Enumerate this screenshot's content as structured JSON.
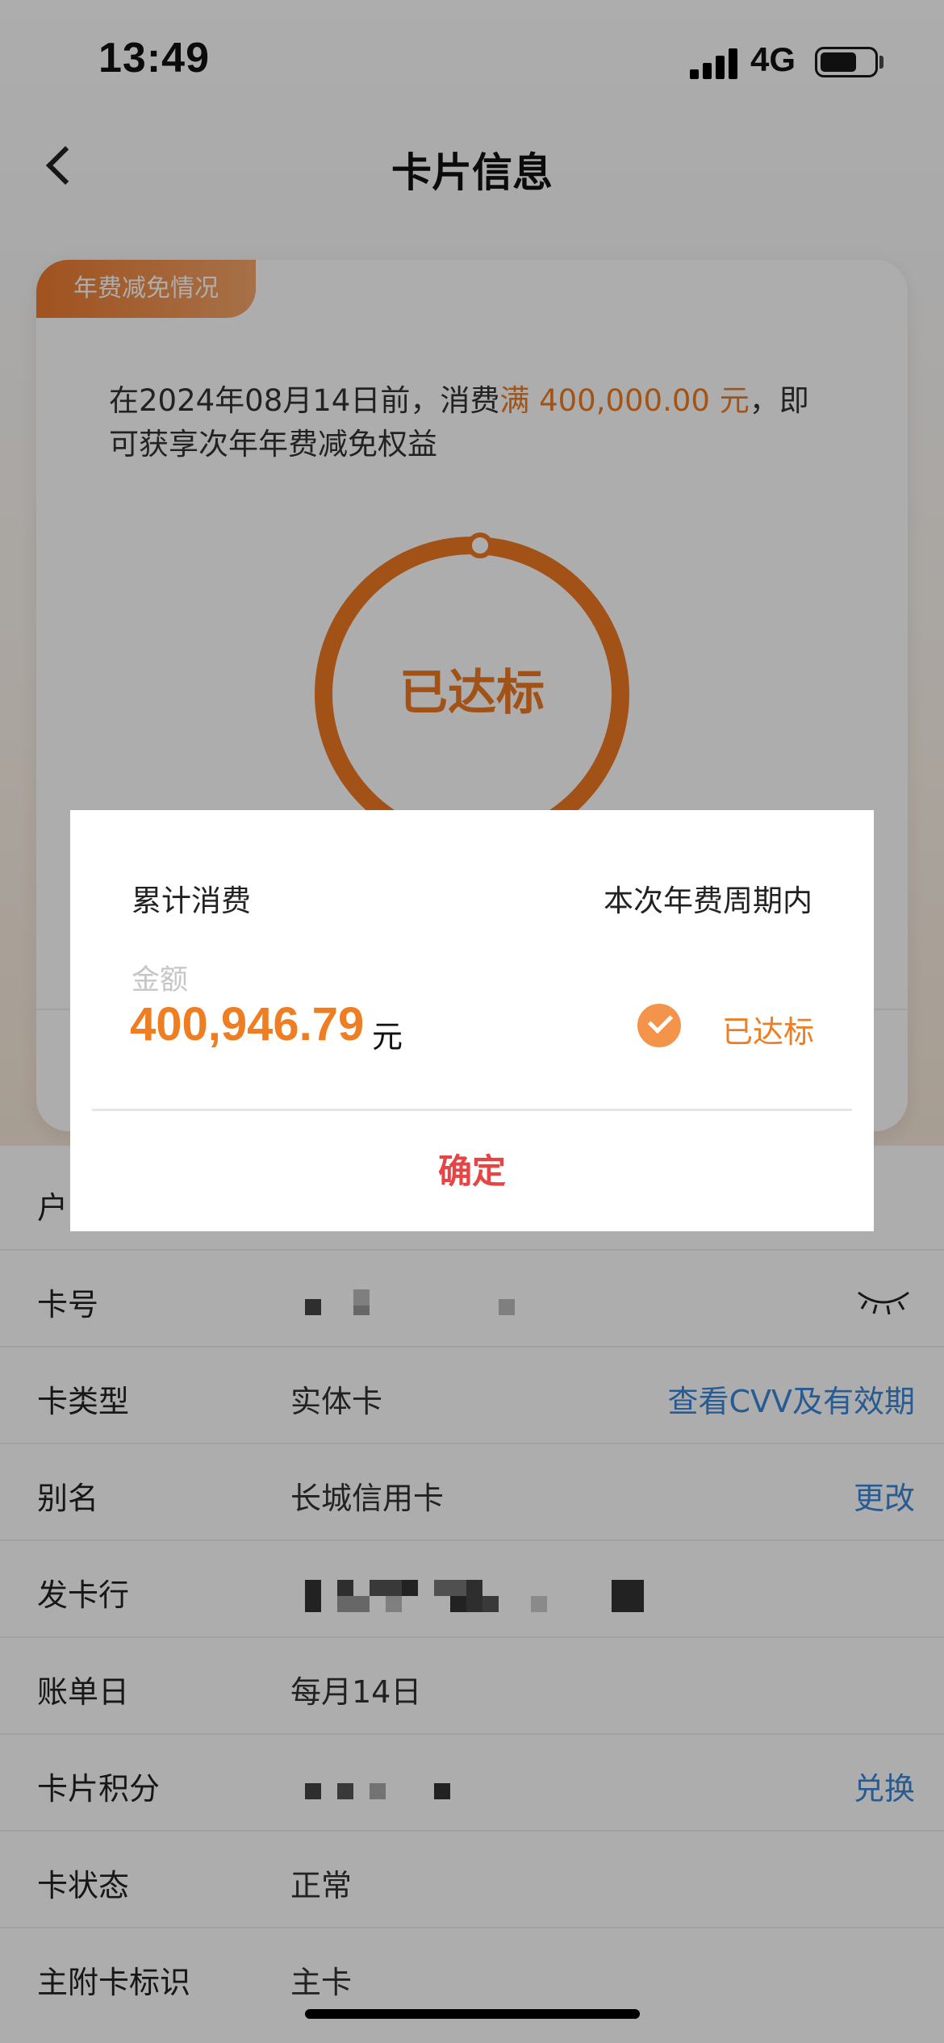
{
  "status_bar": {
    "time": "13:49",
    "network": "4G"
  },
  "nav": {
    "title": "卡片信息"
  },
  "fee_card": {
    "tag": "年费减免情况",
    "desc_prefix": "在2024年08月14日前，消费",
    "desc_highlight": "满 400,000.00 元",
    "desc_suffix": "，即可获享次年年费减免权益",
    "ring_label": "已达标",
    "progress": 1.0
  },
  "info_rows": [
    {
      "label": "户",
      "value": "",
      "action": ""
    },
    {
      "label": "卡号",
      "value": "",
      "action": ""
    },
    {
      "label": "卡类型",
      "value": "实体卡",
      "action": "查看CVV及有效期"
    },
    {
      "label": "别名",
      "value": "长城信用卡",
      "action": "更改"
    },
    {
      "label": "发卡行",
      "value": "",
      "action": ""
    },
    {
      "label": "账单日",
      "value": "每月14日",
      "action": ""
    },
    {
      "label": "卡片积分",
      "value": "",
      "action": "兑换"
    },
    {
      "label": "卡状态",
      "value": "正常",
      "action": ""
    },
    {
      "label": "主附卡标识",
      "value": "主卡",
      "action": ""
    }
  ],
  "dialog": {
    "left_title": "累计消费",
    "right_title": "本次年费周期内",
    "amount_label": "金额",
    "amount": "400,946.79",
    "unit": "元",
    "status": "已达标",
    "confirm": "确定"
  },
  "colors": {
    "accent": "#ef7d22",
    "link": "#3a86d8",
    "confirm": "#e54545"
  },
  "icons": [
    "back-icon",
    "signal-icon",
    "battery-icon",
    "eye-closed-icon",
    "check-circle-icon"
  ]
}
